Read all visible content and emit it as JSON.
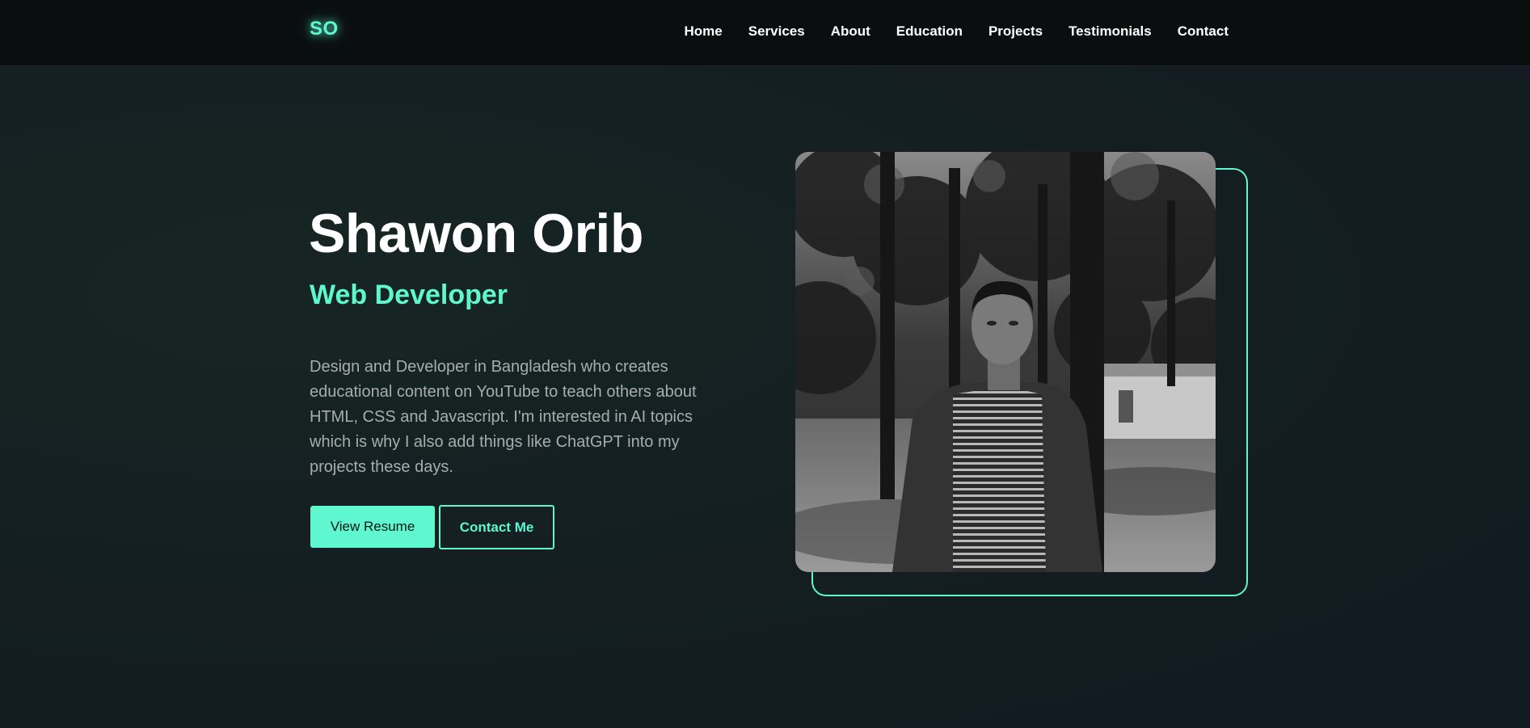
{
  "header": {
    "logo": "SO",
    "nav": [
      "Home",
      "Services",
      "About",
      "Education",
      "Projects",
      "Testimonials",
      "Contact"
    ]
  },
  "hero": {
    "name": "Shawon Orib",
    "role": "Web Developer",
    "description": "Design and Developer in Bangladesh who creates educational content on YouTube to teach others about HTML, CSS and Javascript. I'm interested in AI topics which is why I also add things like ChatGPT into my projects these days.",
    "buttons": {
      "resume": "View Resume",
      "contact": "Contact Me"
    },
    "photo_icon": "portrait-photo"
  },
  "colors": {
    "accent": "#5ef7d0",
    "background": "#131c1f",
    "navbar": "#0b0e0e",
    "text_muted": "#a6adad"
  }
}
